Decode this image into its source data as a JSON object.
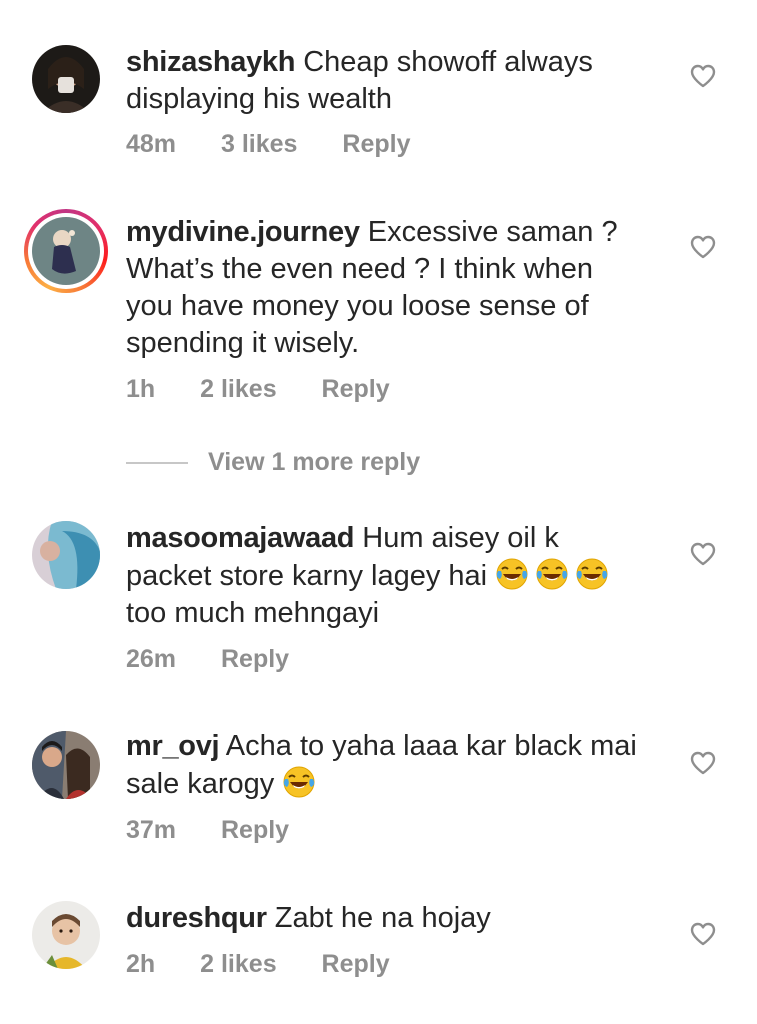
{
  "comments": [
    {
      "username": "shizashaykh",
      "text": "Cheap showoff always displaying his wealth",
      "time": "48m",
      "likes": "3 likes",
      "reply": "Reply",
      "emoji_count": 0
    },
    {
      "username": "mydivine.journey",
      "text": "Excessive saman ? What’s the even need ? I think when you have money you loose sense of spending it wisely.",
      "time": "1h",
      "likes": "2 likes",
      "reply": "Reply",
      "has_story_ring": true,
      "emoji_count": 0
    },
    {
      "username": "masoomajawaad",
      "text_before_emoji": "Hum aisey oil k packet store karny lagey hai",
      "text_after_emoji": "too much mehngayi",
      "emoji_icon": "face-with-tears-of-joy-icon",
      "emoji_count": 3,
      "time": "26m",
      "reply": "Reply"
    },
    {
      "username": "mr_ovj",
      "text_before_emoji": "Acha to yaha laaa kar black mai sale karogy",
      "emoji_icon": "face-with-tears-of-joy-icon",
      "emoji_count": 1,
      "time": "37m",
      "reply": "Reply"
    },
    {
      "username": "dureshqur",
      "text": "Zabt he na hojay",
      "time": "2h",
      "likes": "2 likes",
      "reply": "Reply",
      "emoji_count": 0
    }
  ],
  "view_more_replies": "View 1 more reply",
  "icons": {
    "like": "heart-outline-icon",
    "emoji": "face-with-tears-of-joy-icon"
  },
  "colors": {
    "text": "#262626",
    "secondary": "#8e8e8e",
    "divider": "#c7c7c7"
  }
}
